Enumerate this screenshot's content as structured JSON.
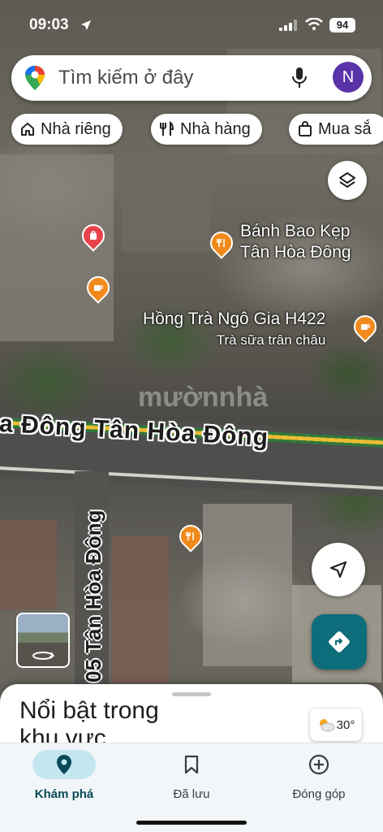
{
  "status_bar": {
    "time": "09:03",
    "battery": "94"
  },
  "search": {
    "placeholder": "Tìm kiếm ở đây",
    "avatar_letter": "N"
  },
  "chips": [
    {
      "label": "Nhà riêng",
      "icon": "home-icon"
    },
    {
      "label": "Nhà hàng",
      "icon": "restaurant-icon"
    },
    {
      "label": "Mua sắ",
      "icon": "shopping-bag-icon"
    }
  ],
  "map": {
    "places": [
      {
        "name_line1": "Bánh Bao Kẹp",
        "name_line2": "Tân Hòa Đông"
      },
      {
        "name": "Hồng Trà Ngô Gia H422",
        "subtitle": "Trà sữa trân châu"
      }
    ],
    "street_main": "a Đông  Tân Hòa Đông",
    "street_side": "05 Tân Hòa Đông",
    "watermark": "mườnnhà"
  },
  "sheet": {
    "title": "Nổi bật trong khu vực",
    "temperature": "30°"
  },
  "nav": {
    "items": [
      {
        "label": "Khám phá",
        "icon": "explore-pin-icon",
        "active": true
      },
      {
        "label": "Đã lưu",
        "icon": "bookmark-icon",
        "active": false
      },
      {
        "label": "Đóng góp",
        "icon": "add-circle-icon",
        "active": false
      }
    ]
  }
}
